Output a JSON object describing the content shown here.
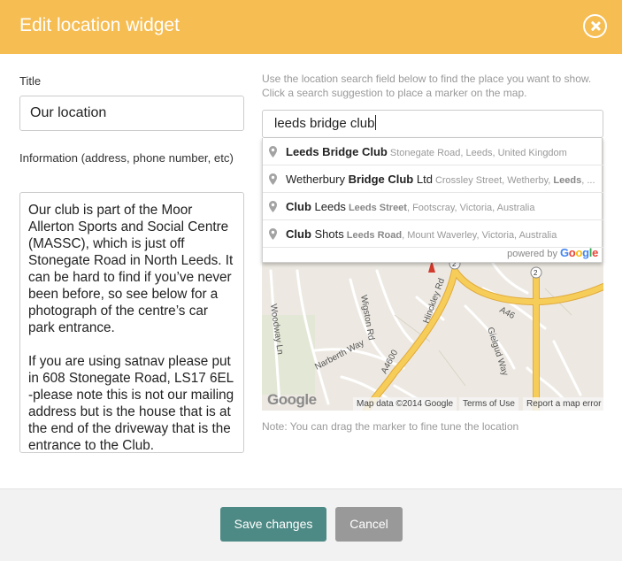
{
  "dialog": {
    "title": "Edit location widget",
    "close_icon": "close-circle-icon"
  },
  "form": {
    "title_label": "Title",
    "title_value": "Our location",
    "info_label": "Information (address, phone number, etc)",
    "info_paragraph_1": "Our club is part of the Moor Allerton Sports and Social Centre (MASSC), which is just off Stonegate Road in North Leeds. It can be hard to find if you’ve never been before, so see below for a photograph of the centre’s car park entrance.",
    "info_paragraph_2": "If you are using satnav please put in 608 Stonegate Road, LS17 6EL -please note this is not our mailing address but is the house that is at the end of the driveway that is the entrance to the Club."
  },
  "location": {
    "help_text": "Use the location search field below to find the place you want to show. Click a search suggestion to place a marker on the map.",
    "search_value": "leeds bridge club",
    "suggestions": [
      {
        "icon": "map-pin-icon",
        "main_bold_1": "Leeds Bridge Club",
        "secondary": "Stonegate Road, Leeds, United Kingdom"
      },
      {
        "icon": "map-pin-icon",
        "main_pre": "Wetherbury ",
        "main_bold_1": "Bridge Club",
        "main_post": " Ltd",
        "secondary": "Crossley Street, Wetherby, ",
        "secondary_bold": "Leeds",
        "secondary_post": ", ..."
      },
      {
        "icon": "map-pin-icon",
        "main_bold_1": "Club",
        "main_post": " Leeds",
        "secondary_bold": "Leeds Street",
        "secondary": ", Footscray, Victoria, Australia"
      },
      {
        "icon": "map-pin-icon",
        "main_bold_1": "Club",
        "main_post": " Shots",
        "secondary_bold": "Leeds Road",
        "secondary": ", Mount Waverley, Victoria, Australia"
      }
    ],
    "powered_by": "powered by",
    "powered_logo": "Google",
    "note": "Note: You can drag the marker to fine tune the location"
  },
  "map": {
    "road_labels": [
      "Hinckley Rd",
      "A46",
      "Gielgud Way",
      "Wigston Rd",
      "Woodway Ln",
      "A4600",
      "Narberth Way"
    ],
    "route_markers": [
      "2",
      "2"
    ],
    "google_logo": "Google",
    "attribution_data": "Map data ©2014 Google",
    "terms": "Terms of Use",
    "report": "Report a map error",
    "colors": {
      "major_road": "#f4c04a",
      "minor_road": "#ffffff",
      "land": "#ede9e2"
    }
  },
  "buttons": {
    "save": "Save changes",
    "cancel": "Cancel"
  },
  "colors": {
    "header": "#f6bd52",
    "save_button": "#4e8a85",
    "cancel_button": "#999999"
  }
}
